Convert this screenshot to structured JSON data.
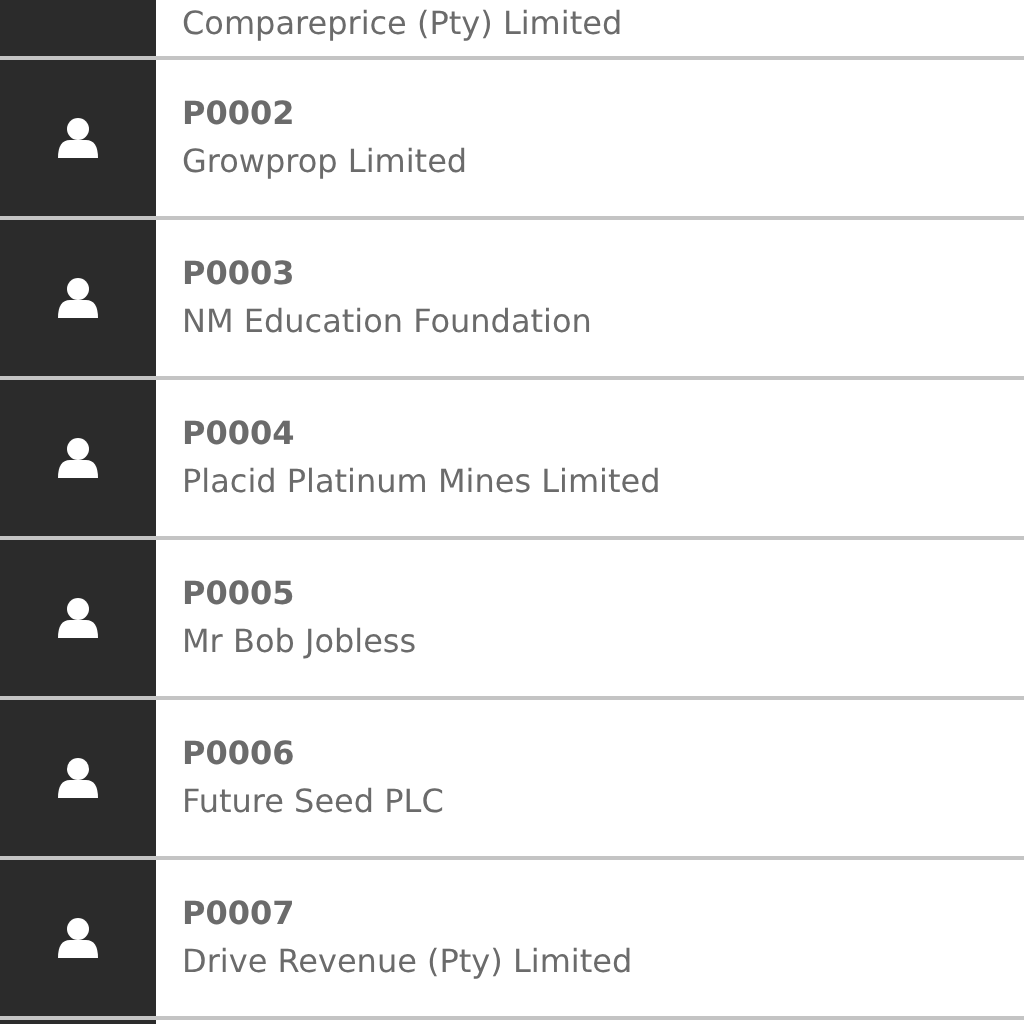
{
  "rows": [
    {
      "name": "Compareprice (Pty) Limited"
    },
    {
      "code": "P0002",
      "name": "Growprop Limited"
    },
    {
      "code": "P0003",
      "name": "NM Education Foundation"
    },
    {
      "code": "P0004",
      "name": "Placid Platinum Mines Limited"
    },
    {
      "code": "P0005",
      "name": "Mr Bob Jobless"
    },
    {
      "code": "P0006",
      "name": "Future Seed PLC"
    },
    {
      "code": "P0007",
      "name": "Drive Revenue (Pty) Limited"
    }
  ]
}
